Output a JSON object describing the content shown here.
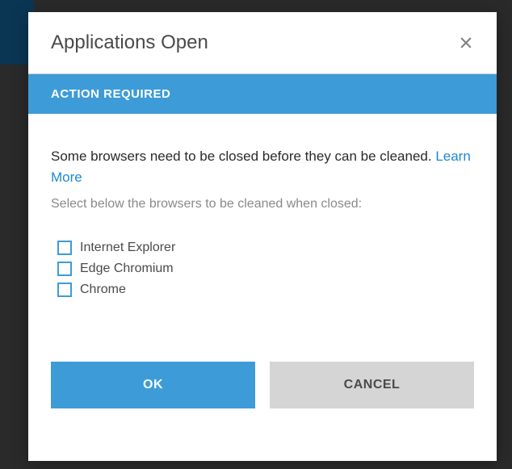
{
  "dialog": {
    "title": "Applications Open",
    "banner": "ACTION REQUIRED",
    "message_prefix": "Some browsers need to be closed before they can be cleaned. ",
    "learn_more": "Learn More",
    "subtext": "Select below the browsers to be cleaned when closed:",
    "checkboxes": [
      {
        "label": "Internet Explorer"
      },
      {
        "label": "Edge Chromium"
      },
      {
        "label": "Chrome"
      }
    ],
    "buttons": {
      "ok": "OK",
      "cancel": "CANCEL"
    }
  }
}
